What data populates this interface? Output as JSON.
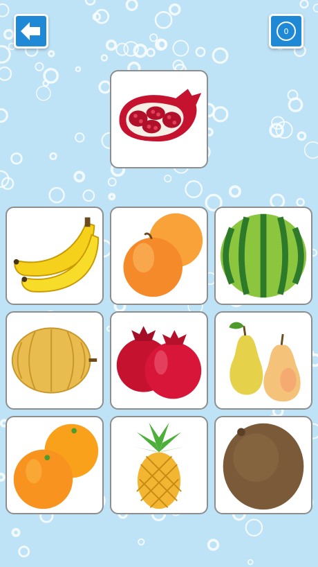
{
  "screen": {
    "background_color": "#bfe3f6",
    "bubble_color": "#ffffff"
  },
  "header": {
    "back_button": {
      "icon": "arrow-left-icon",
      "color": "#1f89d6"
    },
    "score_badge": {
      "value": "0",
      "color": "#1f89d6"
    }
  },
  "target": {
    "fruit": "pomegranate-half"
  },
  "grid": {
    "cards": [
      {
        "fruit": "banana"
      },
      {
        "fruit": "peach"
      },
      {
        "fruit": "watermelon"
      },
      {
        "fruit": "melon"
      },
      {
        "fruit": "pomegranate"
      },
      {
        "fruit": "pear"
      },
      {
        "fruit": "orange"
      },
      {
        "fruit": "pineapple"
      },
      {
        "fruit": "kiwi"
      }
    ]
  }
}
